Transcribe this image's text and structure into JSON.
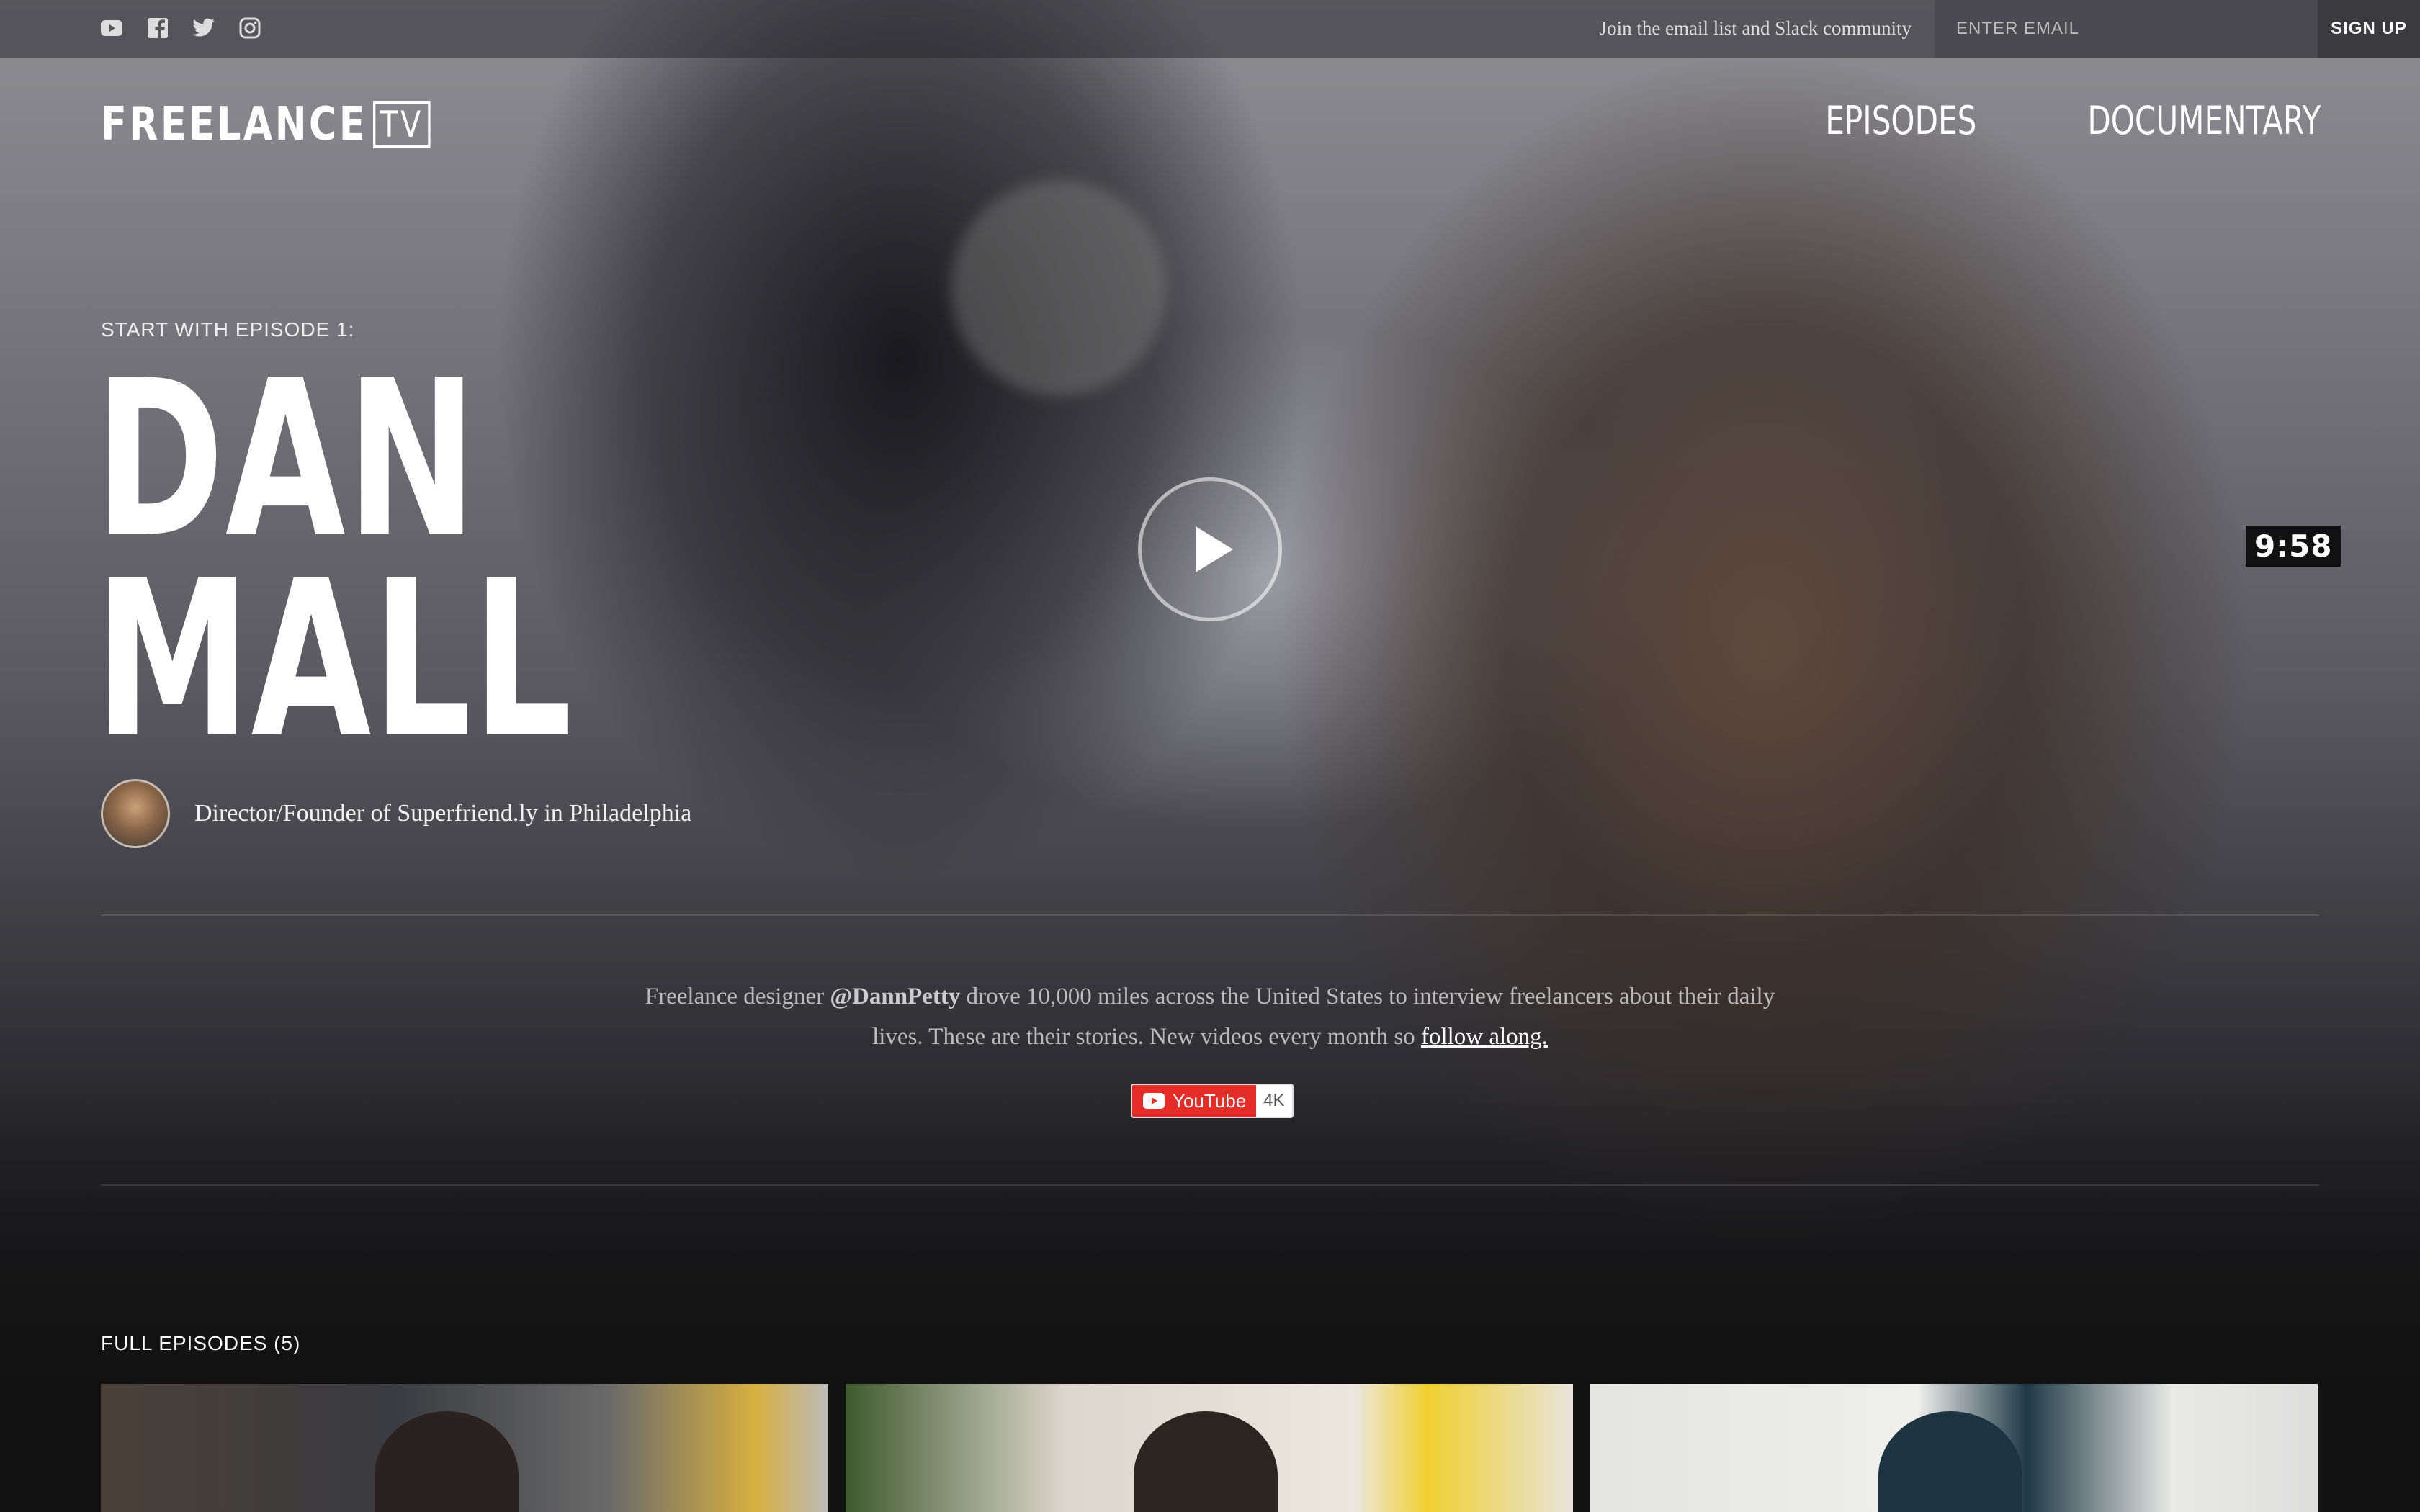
{
  "topbar": {
    "social": [
      "youtube-icon",
      "facebook-icon",
      "twitter-icon",
      "instagram-icon"
    ],
    "join_text": "Join the email list and Slack community",
    "email_placeholder": "ENTER EMAIL",
    "signup_label": "SIGN UP"
  },
  "header": {
    "logo_text": "FREELANCE",
    "logo_badge": "TV",
    "nav": [
      "EPISODES",
      "DOCUMENTARY"
    ]
  },
  "hero": {
    "start_label": "START WITH EPISODE 1:",
    "name_line1": "DAN",
    "name_line2": "MALL",
    "role": "Director/Founder of Superfriend.ly in Philadelphia",
    "duration": "9:58"
  },
  "intro": {
    "text_before": "Freelance designer ",
    "handle": "@DannPetty",
    "text_after": " drove 10,000 miles across the United States to interview freelancers about their daily lives. These are their stories. New videos every month so ",
    "link": "follow along."
  },
  "badge": {
    "youtube": "YouTube",
    "quality": "4K"
  },
  "episodes": {
    "title": "FULL EPISODES (5)"
  },
  "colors": {
    "youtube_red": "#e52d27",
    "background": "#121212"
  }
}
